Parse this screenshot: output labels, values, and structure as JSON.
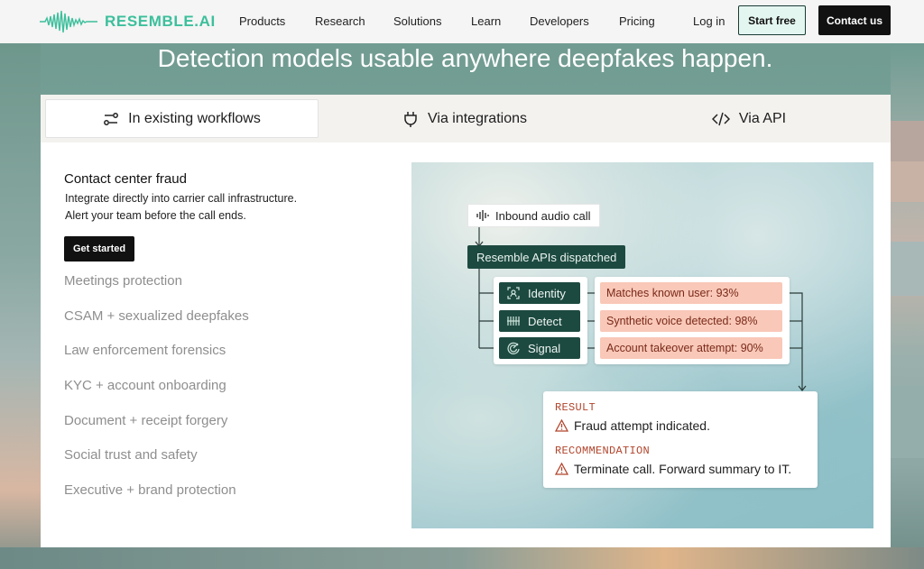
{
  "nav": {
    "logo_text": "RESEMBLE.AI",
    "links": [
      "Products",
      "Research",
      "Solutions",
      "Learn",
      "Developers",
      "Pricing"
    ],
    "login": "Log in",
    "start_free": "Start free",
    "contact_us": "Contact us"
  },
  "headline": "Detection models usable anywhere deepfakes happen.",
  "tabs": [
    {
      "label": "In existing workflows",
      "icon": "workflow-icon",
      "active": true
    },
    {
      "label": "Via integrations",
      "icon": "plug-icon",
      "active": false
    },
    {
      "label": "Via API",
      "icon": "code-icon",
      "active": false
    }
  ],
  "active_case": {
    "title": "Contact center fraud",
    "desc_line1": "Integrate directly into carrier call infrastructure.",
    "desc_line2": "Alert your team before the call ends.",
    "button": "Get started"
  },
  "use_cases": [
    "Meetings protection",
    "CSAM + sexualized deepfakes",
    "Law enforcement forensics",
    "KYC + account onboarding",
    "Document + receipt forgery",
    "Social trust and safety",
    "Executive + brand protection"
  ],
  "diagram": {
    "inbound": "Inbound audio call",
    "dispatched": "Resemble APIs dispatched",
    "apis": [
      {
        "label": "Identity",
        "icon": "identity-icon"
      },
      {
        "label": "Detect",
        "icon": "detect-icon"
      },
      {
        "label": "Signal",
        "icon": "signal-icon"
      }
    ],
    "findings": [
      "Matches known user: 93%",
      "Synthetic voice detected: 98%",
      "Account takeover attempt: 90%"
    ],
    "result_label": "RESULT",
    "result_text": "Fraud attempt indicated.",
    "recommendation_label": "RECOMMENDATION",
    "recommendation_text": "Terminate call. Forward summary to IT."
  },
  "colors": {
    "brand": "#3cbf9c",
    "dark_green": "#1d4a40",
    "finding_bg": "#f9c8b8",
    "label_red": "#b1452c"
  }
}
